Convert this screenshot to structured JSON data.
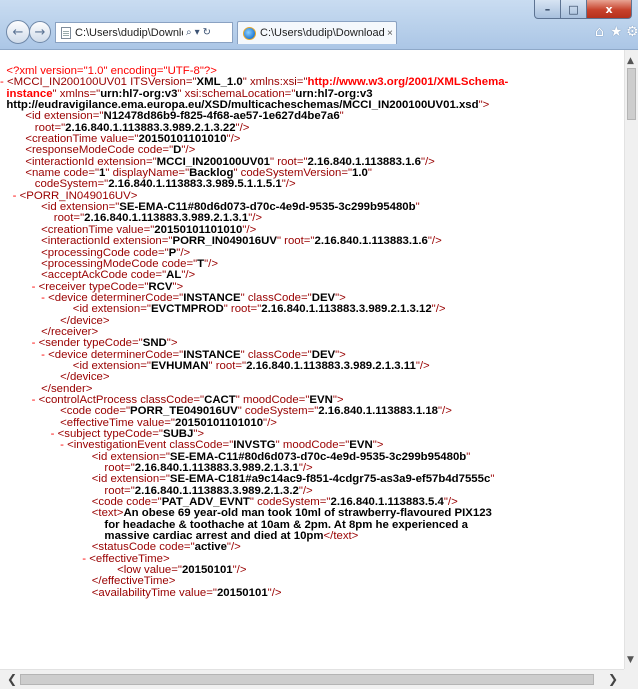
{
  "window": {
    "min_glyph": "–",
    "max_glyph": "□",
    "close_glyph": "x"
  },
  "toolbar": {
    "back_glyph": "←",
    "forward_glyph": "→",
    "address": "C:\\Users\\dudip\\Downlc",
    "search_glyph": "⌕",
    "dropdown_glyph": "▾",
    "refresh_glyph": "↻",
    "tab_title": "C:\\Users\\dudip\\Downloads...",
    "tab_close": "×",
    "home_glyph": "⌂",
    "favorites_glyph": "★",
    "tools_glyph": "⚙"
  },
  "scrollbars": {
    "up": "▲",
    "down": "▼",
    "left": "❮",
    "right": "❯"
  },
  "xml_lines": [
    [
      [
        "m",
        "  <?xml version=\"1.0\" encoding=\"UTF-8\"?>"
      ]
    ],
    [
      [
        "m",
        "- "
      ],
      [
        "t",
        "<MCCI_IN200100UV01 ITSVersion=\""
      ],
      [
        "v",
        "XML_1.0"
      ],
      [
        "t",
        "\" xmlns:xsi=\""
      ],
      [
        "n",
        "http://www.w3.org/2001/XMLSchema-"
      ]
    ],
    [
      [
        "n",
        "  instance"
      ],
      [
        "t",
        "\" xmlns=\""
      ],
      [
        "v",
        "urn:hl7-org:v3"
      ],
      [
        "t",
        "\" xsi:schemaLocation=\""
      ],
      [
        "v",
        "urn:hl7-org:v3"
      ]
    ],
    [
      [
        "v",
        "  http://eudravigilance.ema.europa.eu/XSD/multicacheschemas/MCCI_IN200100UV01.xsd"
      ],
      [
        "t",
        "\">"
      ]
    ],
    [
      [
        "t",
        "        <id extension=\""
      ],
      [
        "v",
        "N12478d86b9-f825-4f68-ae57-1e627d4be7a6"
      ],
      [
        "t",
        "\""
      ]
    ],
    [
      [
        "t",
        "           root=\""
      ],
      [
        "v",
        "2.16.840.1.113883.3.989.2.1.3.22"
      ],
      [
        "t",
        "\"/>"
      ]
    ],
    [
      [
        "t",
        "        <creationTime value=\""
      ],
      [
        "v",
        "20150101101010"
      ],
      [
        "t",
        "\"/>"
      ]
    ],
    [
      [
        "t",
        "        <responseModeCode code=\""
      ],
      [
        "v",
        "D"
      ],
      [
        "t",
        "\"/>"
      ]
    ],
    [
      [
        "t",
        "        <interactionId extension=\""
      ],
      [
        "v",
        "MCCI_IN200100UV01"
      ],
      [
        "t",
        "\" root=\""
      ],
      [
        "v",
        "2.16.840.1.113883.1.6"
      ],
      [
        "t",
        "\"/>"
      ]
    ],
    [
      [
        "t",
        "        <name code=\""
      ],
      [
        "v",
        "1"
      ],
      [
        "t",
        "\" displayName=\""
      ],
      [
        "v",
        "Backlog"
      ],
      [
        "t",
        "\" codeSystemVersion=\""
      ],
      [
        "v",
        "1.0"
      ],
      [
        "t",
        "\""
      ]
    ],
    [
      [
        "t",
        "           codeSystem=\""
      ],
      [
        "v",
        "2.16.840.1.113883.3.989.5.1.1.5.1"
      ],
      [
        "t",
        "\"/>"
      ]
    ],
    [
      [
        "m",
        "    - "
      ],
      [
        "t",
        "<PORR_IN049016UV>"
      ]
    ],
    [
      [
        "t",
        "             <id extension=\""
      ],
      [
        "v",
        "SE-EMA-C11#80d6d073-d70c-4e9d-9535-3c299b95480b"
      ],
      [
        "t",
        "\""
      ]
    ],
    [
      [
        "t",
        "                 root=\""
      ],
      [
        "v",
        "2.16.840.1.113883.3.989.2.1.3.1"
      ],
      [
        "t",
        "\"/>"
      ]
    ],
    [
      [
        "t",
        "             <creationTime value=\""
      ],
      [
        "v",
        "20150101101010"
      ],
      [
        "t",
        "\"/>"
      ]
    ],
    [
      [
        "t",
        "             <interactionId extension=\""
      ],
      [
        "v",
        "PORR_IN049016UV"
      ],
      [
        "t",
        "\" root=\""
      ],
      [
        "v",
        "2.16.840.1.113883.1.6"
      ],
      [
        "t",
        "\"/>"
      ]
    ],
    [
      [
        "t",
        "             <processingCode code=\""
      ],
      [
        "v",
        "P"
      ],
      [
        "t",
        "\"/>"
      ]
    ],
    [
      [
        "t",
        "             <processingModeCode code=\""
      ],
      [
        "v",
        "T"
      ],
      [
        "t",
        "\"/>"
      ]
    ],
    [
      [
        "t",
        "             <acceptAckCode code=\""
      ],
      [
        "v",
        "AL"
      ],
      [
        "t",
        "\"/>"
      ]
    ],
    [
      [
        "m",
        "          - "
      ],
      [
        "t",
        "<receiver typeCode=\""
      ],
      [
        "v",
        "RCV"
      ],
      [
        "t",
        "\">"
      ]
    ],
    [
      [
        "m",
        "             - "
      ],
      [
        "t",
        "<device determinerCode=\""
      ],
      [
        "v",
        "INSTANCE"
      ],
      [
        "t",
        "\" classCode=\""
      ],
      [
        "v",
        "DEV"
      ],
      [
        "t",
        "\">"
      ]
    ],
    [
      [
        "t",
        "                       <id extension=\""
      ],
      [
        "v",
        "EVCTMPROD"
      ],
      [
        "t",
        "\" root=\""
      ],
      [
        "v",
        "2.16.840.1.113883.3.989.2.1.3.12"
      ],
      [
        "t",
        "\"/>"
      ]
    ],
    [
      [
        "t",
        "                   </device>"
      ]
    ],
    [
      [
        "t",
        "             </receiver>"
      ]
    ],
    [
      [
        "m",
        "          - "
      ],
      [
        "t",
        "<sender typeCode=\""
      ],
      [
        "v",
        "SND"
      ],
      [
        "t",
        "\">"
      ]
    ],
    [
      [
        "m",
        "             - "
      ],
      [
        "t",
        "<device determinerCode=\""
      ],
      [
        "v",
        "INSTANCE"
      ],
      [
        "t",
        "\" classCode=\""
      ],
      [
        "v",
        "DEV"
      ],
      [
        "t",
        "\">"
      ]
    ],
    [
      [
        "t",
        "                       <id extension=\""
      ],
      [
        "v",
        "EVHUMAN"
      ],
      [
        "t",
        "\" root=\""
      ],
      [
        "v",
        "2.16.840.1.113883.3.989.2.1.3.11"
      ],
      [
        "t",
        "\"/>"
      ]
    ],
    [
      [
        "t",
        "                   </device>"
      ]
    ],
    [
      [
        "t",
        "             </sender>"
      ]
    ],
    [
      [
        "m",
        "          - "
      ],
      [
        "t",
        "<controlActProcess classCode=\""
      ],
      [
        "v",
        "CACT"
      ],
      [
        "t",
        "\" moodCode=\""
      ],
      [
        "v",
        "EVN"
      ],
      [
        "t",
        "\">"
      ]
    ],
    [
      [
        "t",
        "                   <code code=\""
      ],
      [
        "v",
        "PORR_TE049016UV"
      ],
      [
        "t",
        "\" codeSystem=\""
      ],
      [
        "v",
        "2.16.840.1.113883.1.18"
      ],
      [
        "t",
        "\"/>"
      ]
    ],
    [
      [
        "t",
        "                   <effectiveTime value=\""
      ],
      [
        "v",
        "20150101101010"
      ],
      [
        "t",
        "\"/>"
      ]
    ],
    [
      [
        "m",
        "                - "
      ],
      [
        "t",
        "<subject typeCode=\""
      ],
      [
        "v",
        "SUBJ"
      ],
      [
        "t",
        "\">"
      ]
    ],
    [
      [
        "m",
        "                   - "
      ],
      [
        "t",
        "<investigationEvent classCode=\""
      ],
      [
        "v",
        "INVSTG"
      ],
      [
        "t",
        "\" moodCode=\""
      ],
      [
        "v",
        "EVN"
      ],
      [
        "t",
        "\">"
      ]
    ],
    [
      [
        "t",
        "                             <id extension=\""
      ],
      [
        "v",
        "SE-EMA-C11#80d6d073-d70c-4e9d-9535-3c299b95480b"
      ],
      [
        "t",
        "\""
      ]
    ],
    [
      [
        "t",
        "                                 root=\""
      ],
      [
        "v",
        "2.16.840.1.113883.3.989.2.1.3.1"
      ],
      [
        "t",
        "\"/>"
      ]
    ],
    [
      [
        "t",
        "                             <id extension=\""
      ],
      [
        "v",
        "SE-EMA-C181#a9c14ac9-f851-4cdgr75-as3a9-ef57b4d7555c"
      ],
      [
        "t",
        "\""
      ]
    ],
    [
      [
        "t",
        "                                 root=\""
      ],
      [
        "v",
        "2.16.840.1.113883.3.989.2.1.3.2"
      ],
      [
        "t",
        "\"/>"
      ]
    ],
    [
      [
        "t",
        "                             <code code=\""
      ],
      [
        "v",
        "PAT_ADV_EVNT"
      ],
      [
        "t",
        "\" codeSystem=\""
      ],
      [
        "v",
        "2.16.840.1.113883.5.4"
      ],
      [
        "t",
        "\"/>"
      ]
    ],
    [
      [
        "t",
        "                             <text>"
      ],
      [
        "txt",
        "An obese 69 year-old man took 10ml of strawberry-flavoured PIX123"
      ]
    ],
    [
      [
        "txt",
        "                                 for headache & toothache at 10am & 2pm. At 8pm he experienced a"
      ]
    ],
    [
      [
        "txt",
        "                                 massive cardiac arrest and died at 10pm"
      ],
      [
        "t",
        "</text>"
      ]
    ],
    [
      [
        "t",
        "                             <statusCode code=\""
      ],
      [
        "v",
        "active"
      ],
      [
        "t",
        "\"/>"
      ]
    ],
    [
      [
        "m",
        "                          - "
      ],
      [
        "t",
        "<effectiveTime>"
      ]
    ],
    [
      [
        "t",
        "                                     <low value=\""
      ],
      [
        "v",
        "20150101"
      ],
      [
        "t",
        "\"/>"
      ]
    ],
    [
      [
        "t",
        "                             </effectiveTime>"
      ]
    ],
    [
      [
        "t",
        "                             <availabilityTime value=\""
      ],
      [
        "v",
        "20150101"
      ],
      [
        "t",
        "\"/>"
      ]
    ]
  ]
}
